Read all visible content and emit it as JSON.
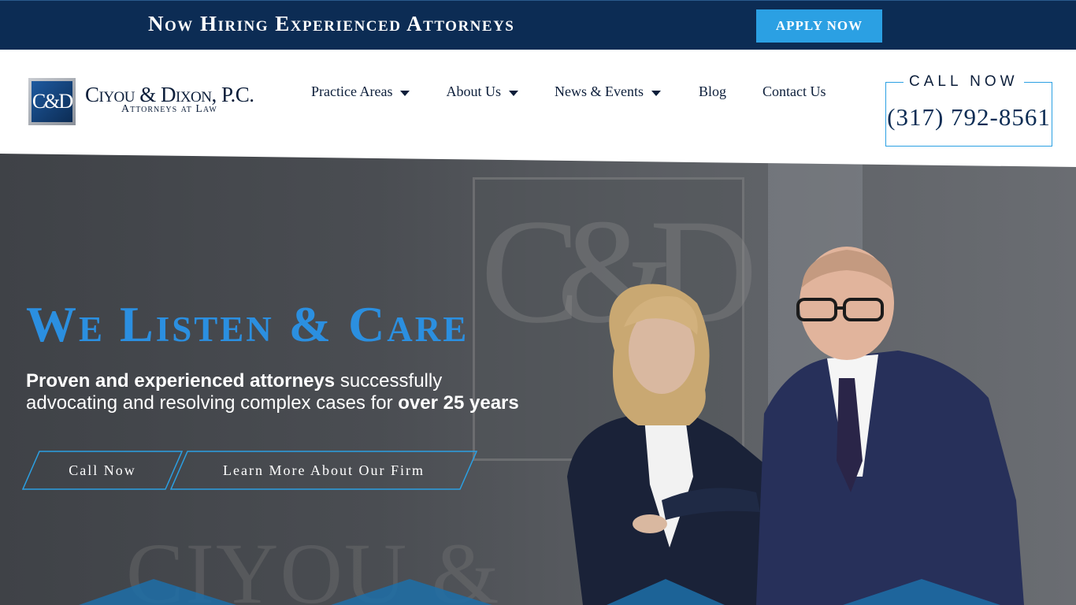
{
  "topbar": {
    "headline": "Now Hiring Experienced Attorneys",
    "apply_label": "APPLY NOW"
  },
  "logo": {
    "mark": "C&D",
    "name": "Ciyou & Dixon, P.C.",
    "subtitle": "Attorneys at Law"
  },
  "nav": {
    "items": [
      {
        "label": "Practice Areas",
        "has_dropdown": true
      },
      {
        "label": "About Us",
        "has_dropdown": true
      },
      {
        "label": "News & Events",
        "has_dropdown": true
      },
      {
        "label": "Blog",
        "has_dropdown": false
      },
      {
        "label": "Contact Us",
        "has_dropdown": false
      }
    ]
  },
  "callbox": {
    "label": "CALL NOW",
    "phone": "(317) 792-8561"
  },
  "hero": {
    "title": "We Listen & Care",
    "sub_bold_1": "Proven and experienced attorneys",
    "sub_text_1": " successfully advocating and resolving complex cases for ",
    "sub_bold_2": "over 25 years",
    "btn_call": "Call Now",
    "btn_learn": "Learn More About Our Firm",
    "watermark": "C&D",
    "watermark2": "CIYOU &"
  },
  "colors": {
    "navy": "#0c2c54",
    "accent_blue": "#2ba0e3",
    "title_blue": "#2b8fe0"
  }
}
